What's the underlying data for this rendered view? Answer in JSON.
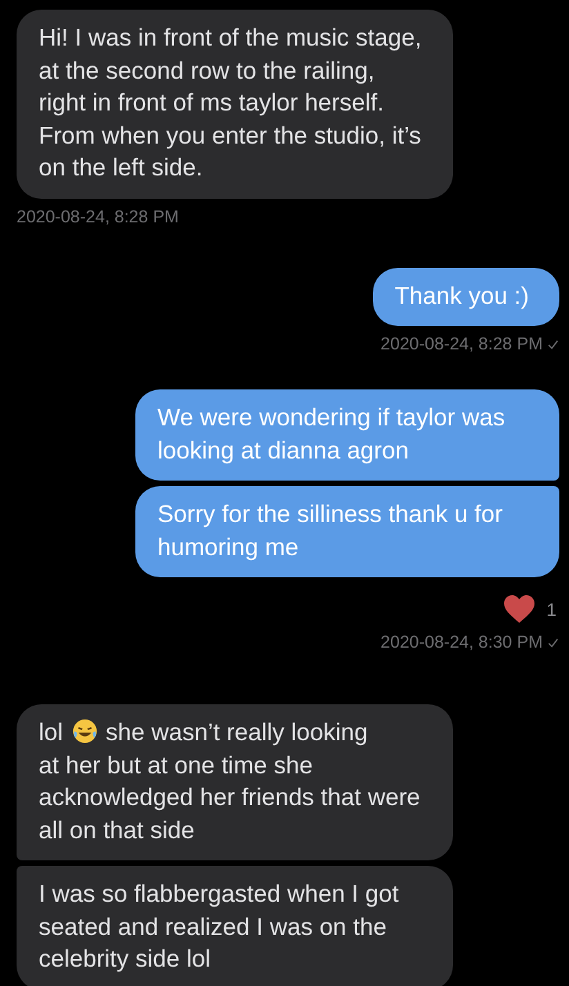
{
  "messages": [
    {
      "kind": "incoming",
      "segments": [
        {
          "kind": "text",
          "text": "Hi! I was in front of the music stage, at the second row to the railing, right in front of ms taylor herself. From when you enter the studio, it’s on the left side."
        }
      ]
    },
    {
      "kind": "timestamp",
      "text": "2020-08-24, 8:28 PM"
    },
    {
      "kind": "outgoing",
      "segments": [
        {
          "kind": "text",
          "text": "Thank you :)"
        }
      ]
    },
    {
      "kind": "timestamp",
      "text": "2020-08-24, 8:28 PM",
      "delivered": true
    },
    {
      "kind": "outgoing",
      "segments": [
        {
          "kind": "text",
          "text": "We were wondering if taylor was looking at dianna agron"
        }
      ]
    },
    {
      "kind": "outgoing",
      "segments": [
        {
          "kind": "text",
          "text": "Sorry for the silliness thank u for humoring me"
        }
      ]
    },
    {
      "kind": "reaction",
      "count": "1"
    },
    {
      "kind": "timestamp",
      "text": "2020-08-24, 8:30 PM",
      "delivered": true
    },
    {
      "kind": "incoming",
      "segments": [
        {
          "kind": "text",
          "text": "lol"
        },
        {
          "kind": "emoji"
        },
        {
          "kind": "text",
          "text": "she wasn’t really looking"
        },
        {
          "kind": "text",
          "text": "at her but at one time she acknowledged her friends that were all on that side"
        }
      ]
    },
    {
      "kind": "incoming",
      "segments": [
        {
          "kind": "text",
          "text": "I was so flabbergasted when I got seated and realized I was on the celebrity side lol"
        }
      ]
    }
  ]
}
